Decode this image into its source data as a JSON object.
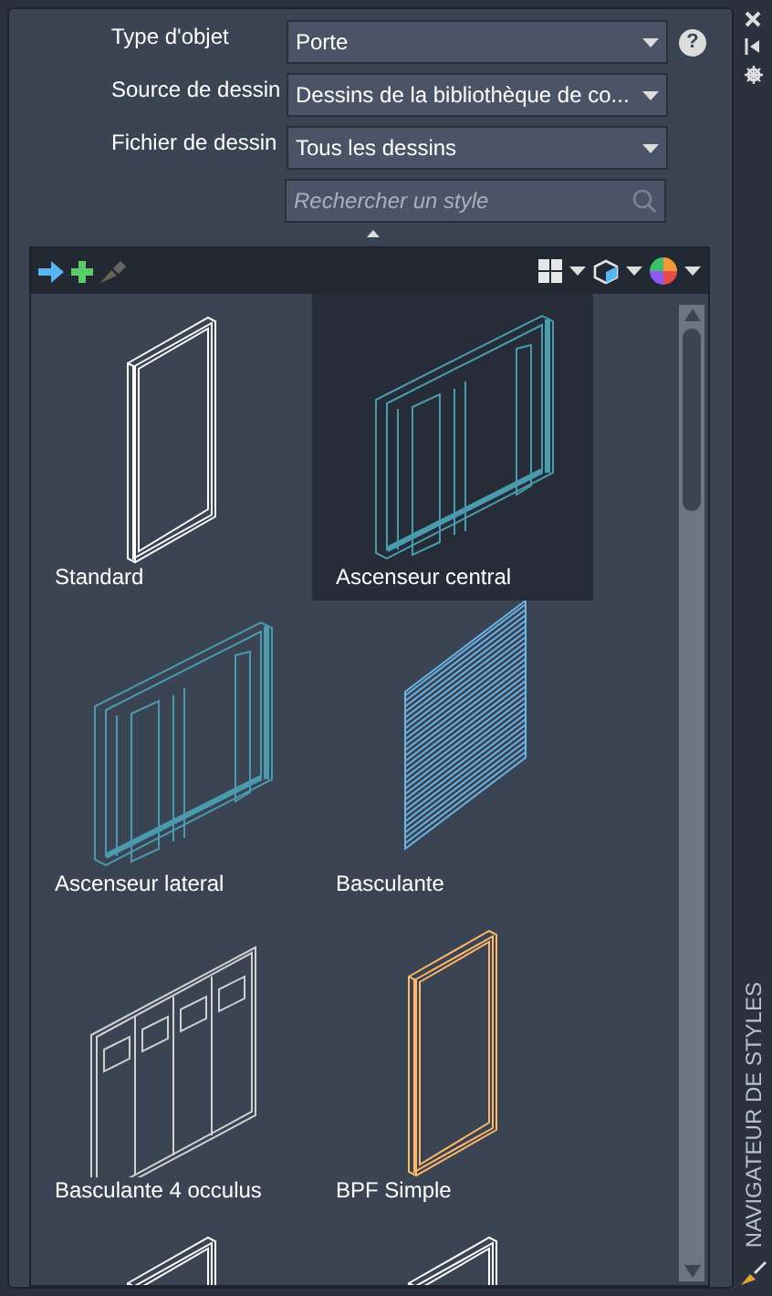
{
  "form": [
    {
      "label": "Type d'objet",
      "value": "Porte",
      "help": "?"
    },
    {
      "label": "Source de dessin",
      "value": "Dessins de la bibliothèque de co..."
    },
    {
      "label": "Fichier de dessin",
      "value": "Tous les dessins"
    }
  ],
  "search": {
    "placeholder": "Rechercher un style"
  },
  "toolbar": {
    "paint_disabled": true
  },
  "styles": [
    {
      "label": "Standard",
      "kind": "door",
      "color": "#ffffff",
      "selected": false
    },
    {
      "label": "Ascenseur central",
      "kind": "sliding",
      "color": "#4a9bb0",
      "selected": true
    },
    {
      "label": "Ascenseur lateral",
      "kind": "sliding",
      "color": "#4a9bb0",
      "selected": false
    },
    {
      "label": "Basculante",
      "kind": "slats",
      "color": "#6ab4e8",
      "selected": false
    },
    {
      "label": "Basculante 4 occulus",
      "kind": "panels",
      "color": "#d0d0d0",
      "selected": false
    },
    {
      "label": "BPF Simple",
      "kind": "door",
      "color": "#ffb86b",
      "selected": false
    },
    {
      "kind": "door",
      "color": "#ffffff",
      "selected": false
    },
    {
      "kind": "door",
      "color": "#ffffff",
      "selected": false
    }
  ],
  "side_title": "NAVIGATEUR DE STYLES"
}
